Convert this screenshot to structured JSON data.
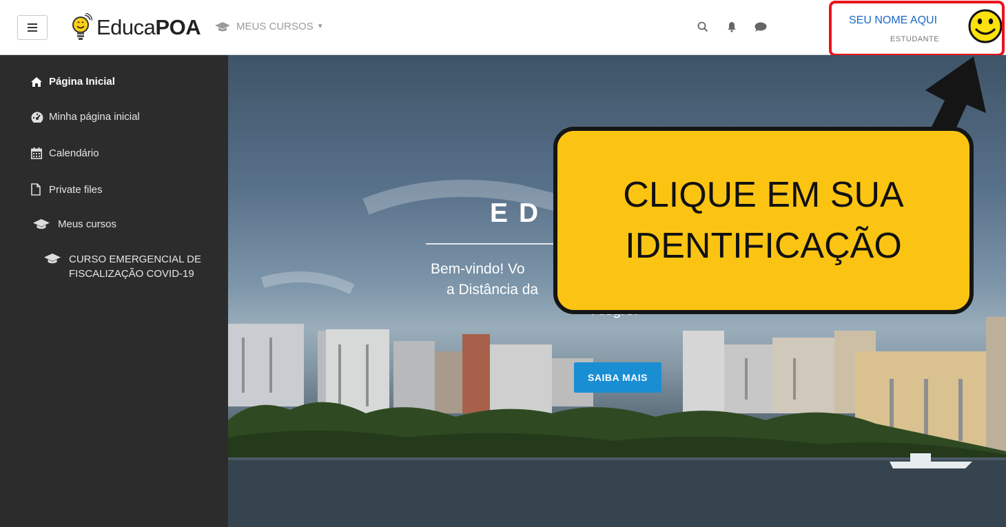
{
  "navbar": {
    "logo_prefix": "Educa",
    "logo_bold": "POA",
    "courses_menu_label": "MEUS CURSOS",
    "icons": [
      "search-icon",
      "bell-icon",
      "chat-icon"
    ]
  },
  "user": {
    "name": "SEU NOME AQUI",
    "role": "ESTUDANTE",
    "avatar_icon": "smiley-icon"
  },
  "sidebar": {
    "items": [
      {
        "label": "Página Inicial",
        "icon": "home-icon",
        "active": true
      },
      {
        "label": "Minha página inicial",
        "icon": "dashboard-icon"
      },
      {
        "label": "Calendário",
        "icon": "calendar-icon"
      },
      {
        "label": "Private files",
        "icon": "file-icon"
      },
      {
        "label": "Meus cursos",
        "icon": "graduation-cap-icon"
      }
    ],
    "course": {
      "label": "CURSO EMERGENCIAL DE FISCALIZAÇÃO COVID-19",
      "icon": "graduation-cap-icon"
    }
  },
  "hero": {
    "title": "ED",
    "text_line1": "Bem-vindo! Vo",
    "text_line2": "a Distância da",
    "text_line3": "Alegre.",
    "button_label": "SAIBA MAIS"
  },
  "callout": {
    "line1": "CLIQUE EM SUA",
    "line2": "IDENTIFICAÇÃO"
  },
  "colors": {
    "accent_blue": "#1a8ed3",
    "callout_yellow": "#fcc412",
    "highlight_red": "#e8141c",
    "sidebar_bg": "#2c2c2c"
  }
}
